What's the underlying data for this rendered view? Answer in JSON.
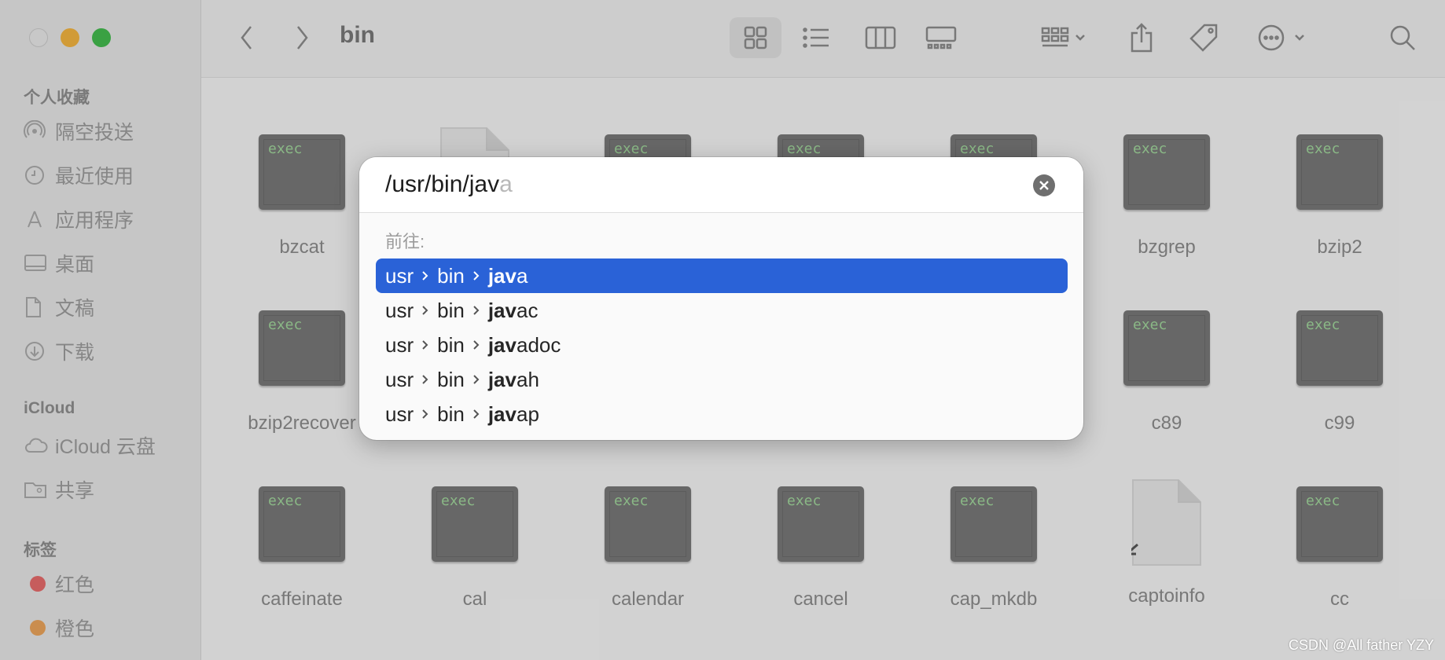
{
  "toolbar": {
    "title": "bin"
  },
  "sidebar": {
    "favorites_title": "个人收藏",
    "favorites": [
      {
        "label": "隔空投送",
        "icon": "airdrop-icon"
      },
      {
        "label": "最近使用",
        "icon": "clock-icon"
      },
      {
        "label": "应用程序",
        "icon": "applications-icon"
      },
      {
        "label": "桌面",
        "icon": "desktop-icon"
      },
      {
        "label": "文稿",
        "icon": "document-icon"
      },
      {
        "label": "下载",
        "icon": "download-icon"
      }
    ],
    "icloud_title": "iCloud",
    "icloud": [
      {
        "label": "iCloud 云盘",
        "icon": "cloud-icon"
      },
      {
        "label": "共享",
        "icon": "shared-folder-icon"
      }
    ],
    "tags_title": "标签",
    "tags": [
      {
        "label": "红色",
        "color": "#e46a6a"
      },
      {
        "label": "橙色",
        "color": "#e8a35a"
      }
    ]
  },
  "files": {
    "exec_label": "exec",
    "row1": [
      "bzcat",
      "",
      "",
      "",
      "",
      "bzgrep",
      "bzip2"
    ],
    "row2": [
      "bzip2recover",
      "c89",
      "c99"
    ],
    "row3": [
      "caffeinate",
      "cal",
      "calendar",
      "cancel",
      "cap_mkdb",
      "captoinfo",
      "cc"
    ]
  },
  "dialog": {
    "input_typed": "/usr/bin/jav",
    "input_suggestion": "a",
    "goto_label": "前往:",
    "results": [
      {
        "p1": "usr",
        "p2": "bin",
        "match": "jav",
        "rest": "a"
      },
      {
        "p1": "usr",
        "p2": "bin",
        "match": "jav",
        "rest": "ac"
      },
      {
        "p1": "usr",
        "p2": "bin",
        "match": "jav",
        "rest": "adoc"
      },
      {
        "p1": "usr",
        "p2": "bin",
        "match": "jav",
        "rest": "ah"
      },
      {
        "p1": "usr",
        "p2": "bin",
        "match": "jav",
        "rest": "ap"
      }
    ]
  },
  "watermark": "CSDN @All father YZY",
  "colors": {
    "selection": "#2a62d7",
    "exec_text": "#9fd49a"
  }
}
